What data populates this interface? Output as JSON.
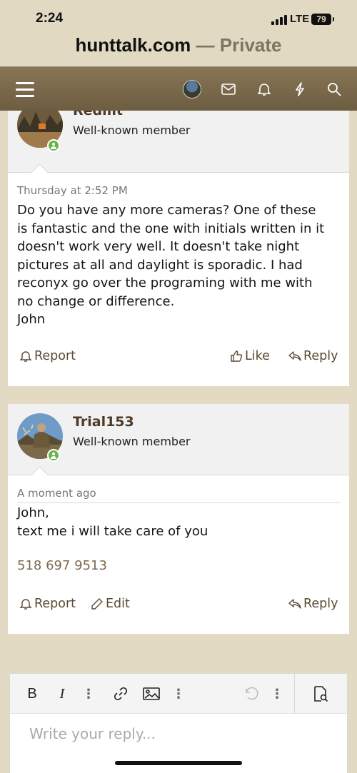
{
  "status": {
    "time": "2:24",
    "network": "LTE",
    "battery": "79"
  },
  "browser": {
    "host": "hunttalk.com",
    "suffix": " — Private"
  },
  "nav": {
    "menu_icon": "hamburger-icon",
    "icons": [
      "avatar",
      "envelope-icon",
      "bell-icon",
      "bolt-icon",
      "search-icon"
    ]
  },
  "posts": [
    {
      "username": "Redmt",
      "user_title": "Well-known member",
      "date": "Thursday at 2:52 PM",
      "body": [
        "Do you have any more cameras? One of these",
        "is fantastic and the one with initials written in it",
        "doesn't work very well. It doesn't take night",
        "pictures at all and daylight is sporadic. I had",
        "reconyx go over the programing with me with",
        "no change or difference.",
        "John"
      ],
      "actions": {
        "report": "Report",
        "like": "Like",
        "reply": "Reply"
      }
    },
    {
      "username": "Trial153",
      "user_title": "Well-known member",
      "date": "A moment ago",
      "body": [
        "John,",
        "text me i will take care of you"
      ],
      "phone": "518 697 9513",
      "actions": {
        "report": "Report",
        "edit": "Edit",
        "reply": "Reply"
      }
    }
  ],
  "editor": {
    "placeholder": "Write your reply...",
    "toolbar": {
      "bold": "B",
      "italic": "I",
      "more": "⋮"
    }
  },
  "colors": {
    "nav": "#7a6a4c",
    "accent": "#5b4a32",
    "online": "#69b44c",
    "background": "#e2dac2"
  }
}
